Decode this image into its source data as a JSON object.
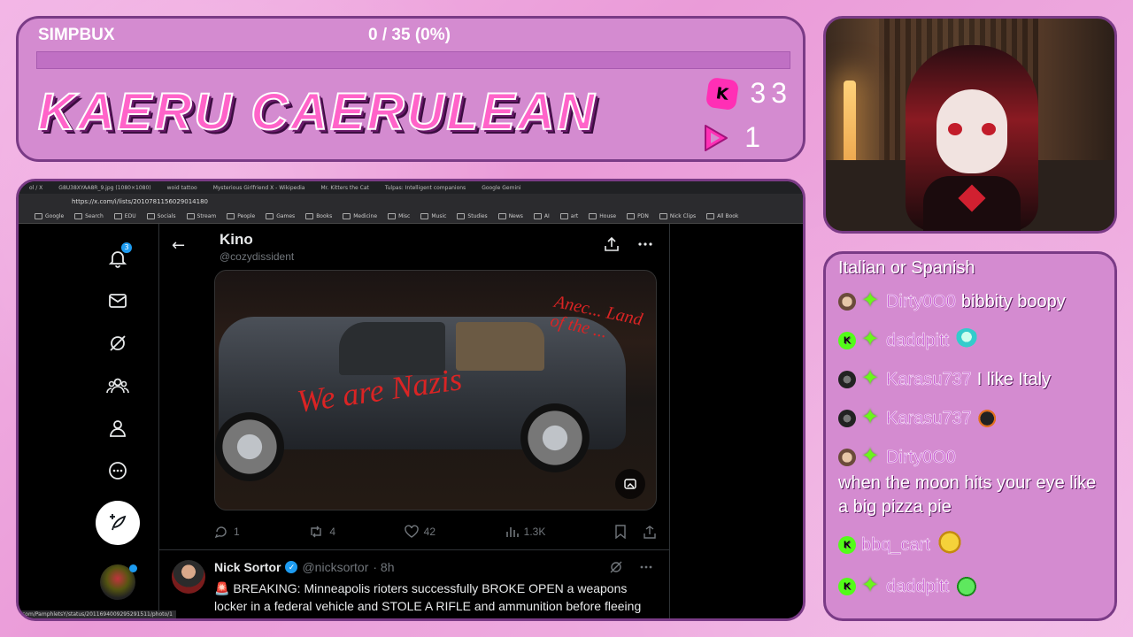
{
  "overlay": {
    "simpbux_label": "SIMPBUX",
    "simpbux_value": "0 / 35 (0%)",
    "simpbux_progress": 0,
    "streamer_name": "KAERU CAERULEAN",
    "kick_count": "33",
    "twitch_count": "1"
  },
  "browser": {
    "tabs": [
      "ol / X",
      "G8U38XYAA8R_9.jpg (1080×1080)",
      "woid tattoo",
      "Mysterious Girlfriend X - Wikipedia",
      "Mr. Kitters the Cat",
      "Tulpas: Intelligent companions",
      "Google Gemini"
    ],
    "url": "https://x.com/i/lists/2010781156029014180",
    "bookmarks": [
      "Google",
      "Search",
      "EDU",
      "Socials",
      "Stream",
      "People",
      "Games",
      "Books",
      "Medicine",
      "Misc",
      "Music",
      "Studies",
      "News",
      "AI",
      "art",
      "House",
      "PDN",
      "Nick Clips"
    ],
    "all_bookmarks": "All Book",
    "status_url": "com/PamphletsY/status/2011694009295291511/photo/1"
  },
  "x": {
    "notif_count": "3",
    "list_title": "Kino",
    "list_handle": "@cozydissident",
    "graffiti_main": "We are Nazis",
    "graffiti_side": "Anec... Land of the ...",
    "replies": "1",
    "reposts": "4",
    "likes": "42",
    "views": "1.3K",
    "tweet2": {
      "name": "Nick Sortor",
      "handle": "@nicksortor",
      "time": "· 8h",
      "text": "🚨 BREAKING: Minneapolis rioters successfully BROKE OPEN a weapons locker in a federal vehicle and STOLE A RIFLE and ammunition before fleeing"
    }
  },
  "chat": {
    "header": "Italian or Spanish",
    "messages": [
      {
        "user": "Dirty0O0",
        "text": "bibbity boopy"
      },
      {
        "user": "daddpitt",
        "text": ""
      },
      {
        "user": "Karasu737",
        "text": "I like Italy"
      },
      {
        "user": "Karasu737",
        "text": ""
      },
      {
        "user": "Dirty0O0",
        "text": ""
      },
      {
        "user": "",
        "text": "when the moon hits your eye like a big pizza pie"
      },
      {
        "user": "bbq_cart",
        "text": ""
      },
      {
        "user": "daddpitt",
        "text": ""
      }
    ]
  },
  "colors": {
    "panel": "#d48bd0",
    "border": "#7a3b86",
    "name_pink": "#ff63c9",
    "kick_green": "#53fc18",
    "x_blue": "#1d9bf0"
  }
}
